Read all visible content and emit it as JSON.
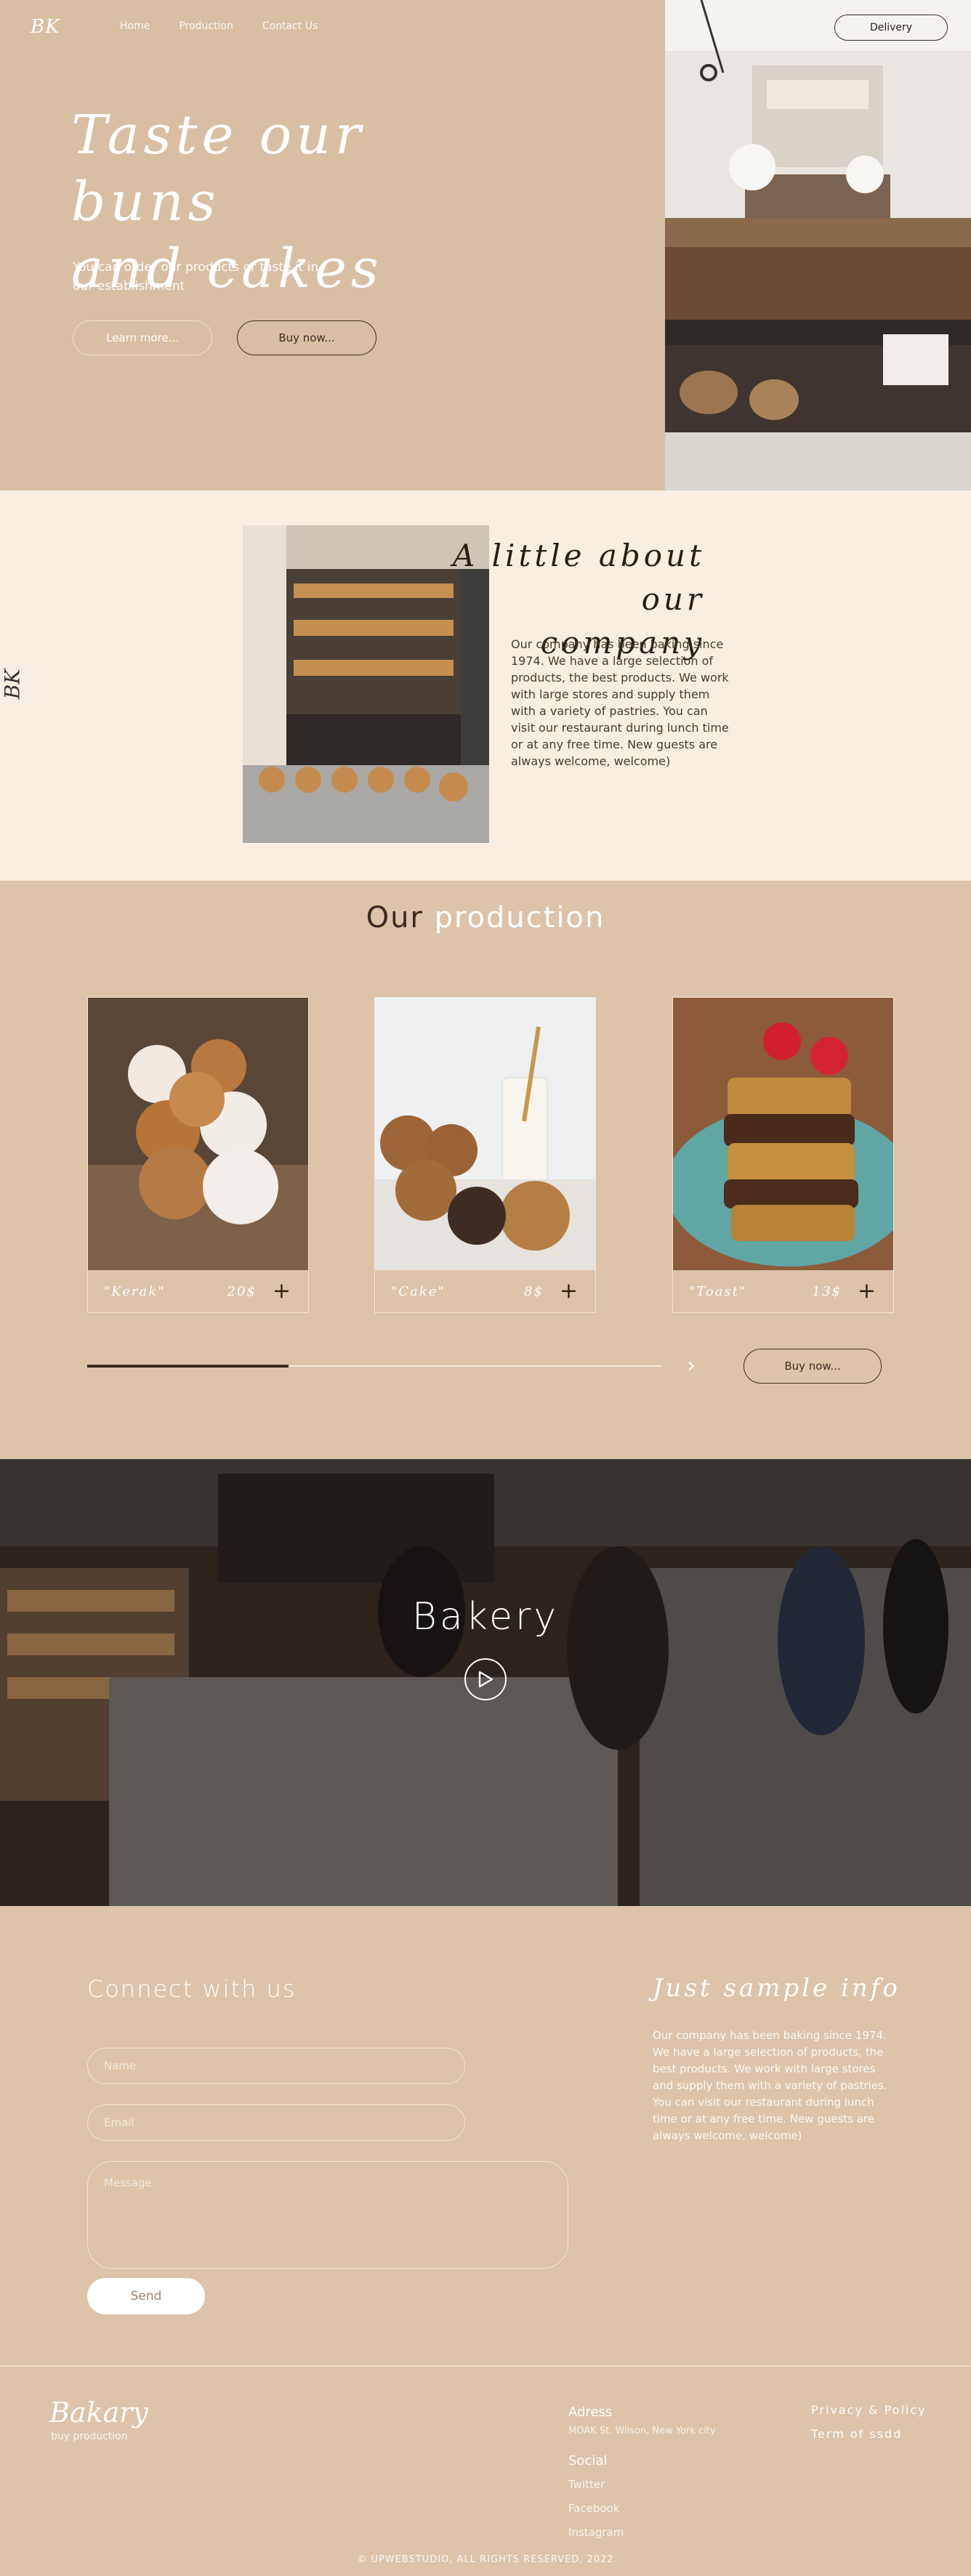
{
  "header": {
    "logo": "BK",
    "nav": [
      "Home",
      "Production",
      "Contact Us"
    ],
    "delivery_label": "Delivery"
  },
  "hero": {
    "title_line1": "Taste our buns",
    "title_line2": "and cakes",
    "subtitle": "You can order our products or taste it in our establishment",
    "learn_more_label": "Learn more...",
    "buy_now_label": "Buy now..."
  },
  "about": {
    "side_logo": "BK",
    "title_line1": "A little about our",
    "title_line2": "company",
    "text": "Our company has been baking since 1974. We have a large selection of products, the best products. We work with large stores and supply them with a variety of pastries. You can visit our restaurant during lunch time or at any free time. New guests are always welcome, welcome)"
  },
  "production": {
    "title_dark": "Our",
    "title_light": "production",
    "products": [
      {
        "name": "\"Kerak\"",
        "price": "20$"
      },
      {
        "name": "\"Cake\"",
        "price": "8$"
      },
      {
        "name": "\"Toast\"",
        "price": "13$"
      }
    ],
    "carousel_progress": 0.35,
    "next_icon": "chevron-right-icon",
    "buy_now_label": "Buy now..."
  },
  "video": {
    "label": "Bakery",
    "play_icon": "play-icon"
  },
  "contact": {
    "title": "Connect with us",
    "name_placeholder": "Name",
    "email_placeholder": "Email",
    "message_placeholder": "Message",
    "send_label": "Send"
  },
  "info": {
    "title": "Just sample info",
    "text": "Our company has been baking since 1974. We have a large selection of products, the best products. We work with large stores and supply them with a variety of pastries. You can visit our restaurant during lunch time or at any free time. New guests are always welcome, welcome)"
  },
  "footer": {
    "logo": "Bakary",
    "tagline": "buy production",
    "address_head": "Adress",
    "address_text": "MOAK St. Wilson, New York city",
    "social_head": "Social",
    "social_links": [
      "Twitter",
      "Facebook",
      "Instagram"
    ],
    "privacy": "Privacy & Policy",
    "terms": "Term of ssdd",
    "copyright": "© UPWEBSTUDIO, ALL RIGHTS RESERVED, 2022"
  },
  "colors": {
    "background": "#dcc3a9",
    "hero_bg": "#d8bea3",
    "about_bg": "#faeee3",
    "dark_text": "#2b1d12"
  }
}
